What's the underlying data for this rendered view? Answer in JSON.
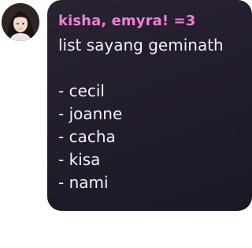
{
  "message": {
    "sender": "kisha, emyra! =3",
    "title_line": "list sayang geminath",
    "items": [
      "- cecil",
      "- joanne",
      "- cacha",
      "- kisa",
      "- nami"
    ]
  },
  "colors": {
    "bubble": "#241f2e",
    "sender": "#f07fd7",
    "text": "#f4f2f7"
  },
  "icons": {
    "avatar": "user-avatar-photo"
  }
}
